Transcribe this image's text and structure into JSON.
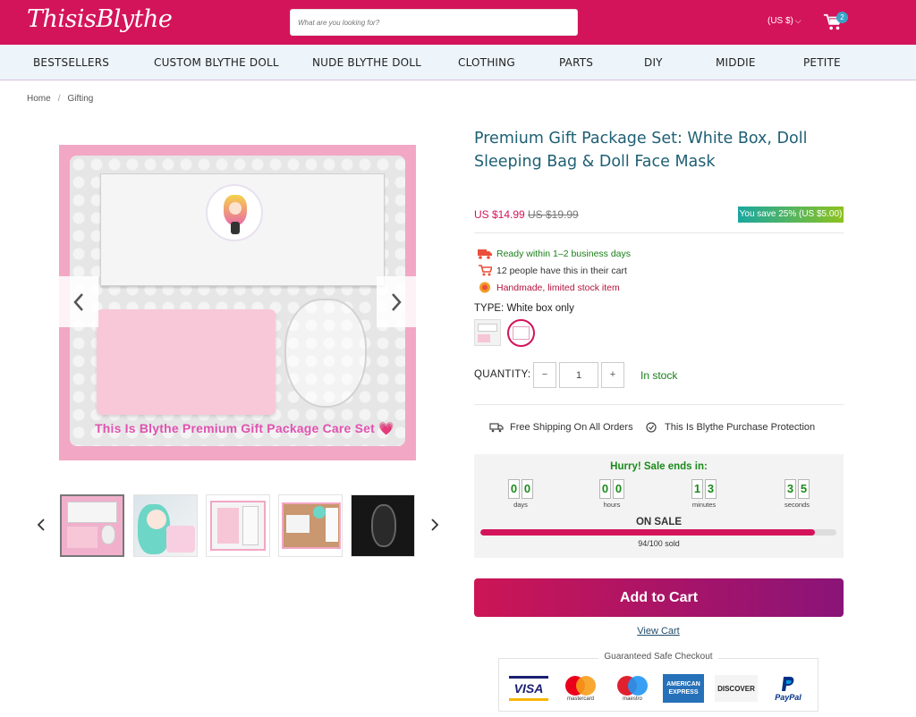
{
  "header": {
    "logo": "ThisisBlythe",
    "search_placeholder": "What are you looking for?",
    "currency": "(US $)",
    "cart_count": "2"
  },
  "nav": {
    "items": [
      "BESTSELLERS",
      "CUSTOM BLYTHE DOLL",
      "NUDE BLYTHE DOLL",
      "CLOTHING",
      "PARTS",
      "DIY",
      "MIDDIE",
      "PETITE"
    ]
  },
  "breadcrumb": {
    "home": "Home",
    "current": "Gifting"
  },
  "gallery": {
    "caption": "This Is Blythe  Premium Gift Package Care Set 💗",
    "thumbnail_count": 5
  },
  "product": {
    "title": "Premium Gift Package Set: White Box, Doll Sleeping Bag & Doll Face Mask",
    "price": "US $14.99",
    "compare_price": "US $19.99",
    "save_badge": "You save 25% (US $5.00)",
    "badges": [
      {
        "icon": "truck-icon",
        "text": "Ready within 1–2 business days",
        "color": "#1a7f1a"
      },
      {
        "icon": "cart-icon",
        "text": "12 people have this in their cart",
        "color": "#333333"
      },
      {
        "icon": "medal-icon",
        "text": "Handmade, limited stock item",
        "color": "#b3123f"
      }
    ],
    "type_label": "TYPE:",
    "type_value": "White box only",
    "quantity_label": "QUANTITY:",
    "quantity": "1",
    "minus": "−",
    "plus": "+",
    "stock": "In stock",
    "shipping": "Free Shipping On All Orders",
    "protection": "This Is Blythe Purchase Protection"
  },
  "countdown": {
    "heading": "Hurry! Sale ends in:",
    "days": [
      "0",
      "0"
    ],
    "hours": [
      "0",
      "0"
    ],
    "minutes": [
      "1",
      "3"
    ],
    "seconds": [
      "3",
      "5"
    ],
    "labels": {
      "days": "days",
      "hours": "hours",
      "minutes": "minutes",
      "seconds": "seconds"
    },
    "on_sale": "ON SALE",
    "sold_text": "94/100 sold",
    "sold_fraction": 0.94
  },
  "actions": {
    "add_to_cart": "Add to Cart",
    "view_cart": "View Cart"
  },
  "checkout": {
    "title": "Guaranteed Safe Checkout",
    "visa": "VISA",
    "mastercard": "mastercard",
    "maestro": "maestro",
    "amex": "AMERICAN EXPRESS",
    "discover": "DISCOVER",
    "paypal": "PayPal"
  },
  "colors": {
    "brand": "#d4145a",
    "nav_bg": "#edf4fa",
    "title": "#1e5f73",
    "stock_green": "#1a7f1a"
  }
}
